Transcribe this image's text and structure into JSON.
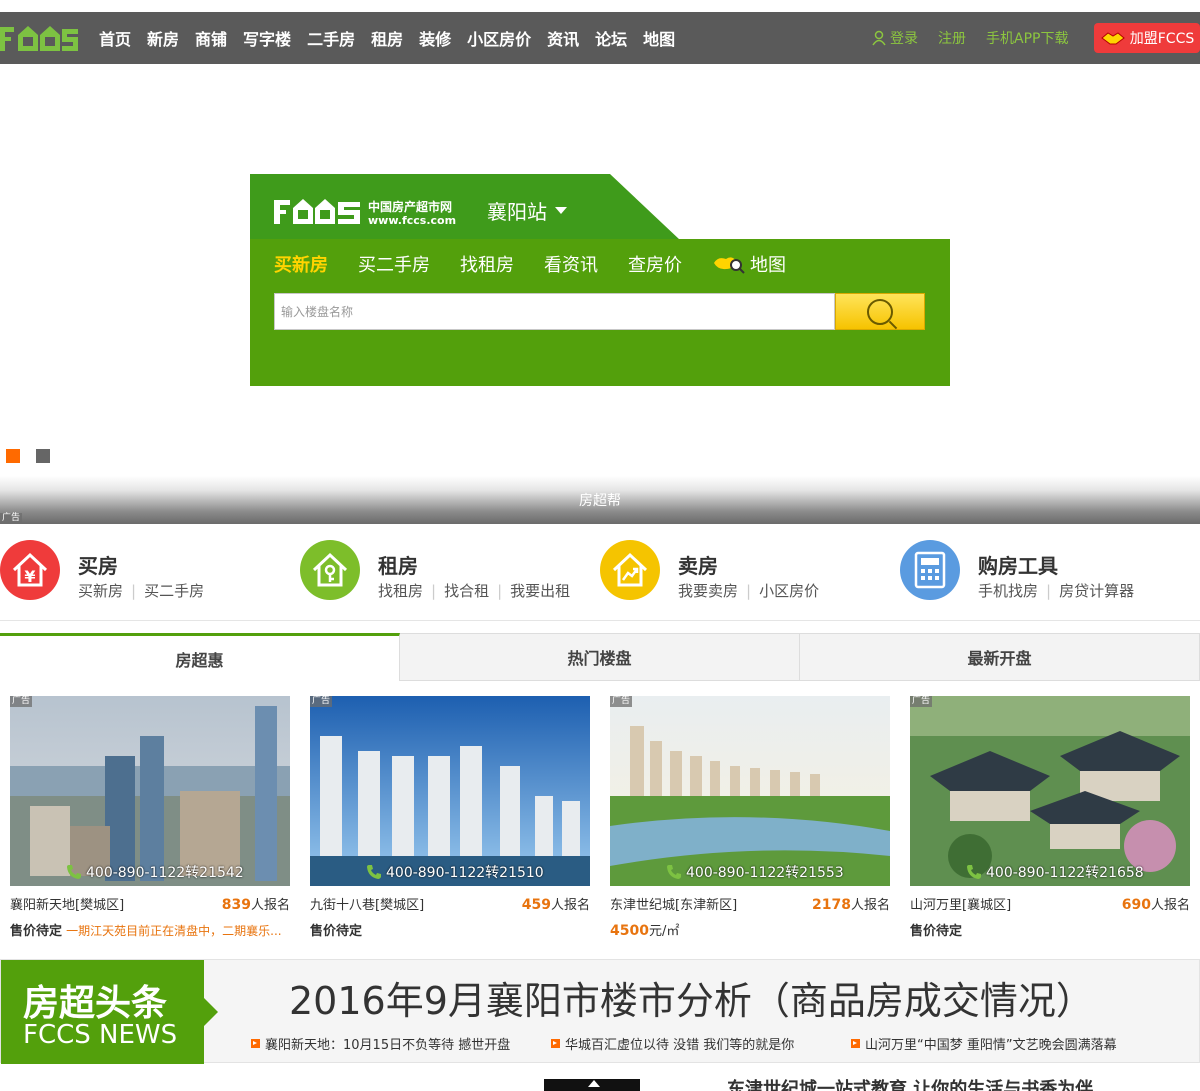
{
  "nav": {
    "logo": "FCCS",
    "items": [
      "首页",
      "新房",
      "商铺",
      "写字楼",
      "二手房",
      "租房",
      "装修",
      "小区房价",
      "资讯",
      "论坛",
      "地图"
    ],
    "login": "登录",
    "register": "注册",
    "app_download": "手机APP下载",
    "join": "加盟FCCS",
    "accent": "#8cc63f"
  },
  "search": {
    "brand": "FCCS",
    "brand_cn": "中国房产超市网",
    "brand_url": "www.fccs.com",
    "city": "襄阳站",
    "tabs": [
      "买新房",
      "买二手房",
      "找租房",
      "看资讯",
      "查房价",
      "地图"
    ],
    "active_tab": "买新房",
    "placeholder": "输入楼盘名称",
    "button_color": "#f6c300"
  },
  "carousel": {
    "pages": 2,
    "active": 1
  },
  "banner": {
    "label": "房超帮",
    "ad": "广告"
  },
  "services": [
    {
      "title": "买房",
      "links": [
        "买新房",
        "买二手房"
      ],
      "icon": "yuan-house-icon",
      "color": "#ef3b3b"
    },
    {
      "title": "租房",
      "links": [
        "找租房",
        "找合租",
        "我要出租"
      ],
      "icon": "key-house-icon",
      "color": "#7dbe2a"
    },
    {
      "title": "卖房",
      "links": [
        "我要卖房",
        "小区房价"
      ],
      "icon": "sell-house-icon",
      "color": "#f5c400"
    },
    {
      "title": "购房工具",
      "links": [
        "手机找房",
        "房贷计算器"
      ],
      "icon": "calculator-icon",
      "color": "#5a9be0"
    }
  ],
  "tabs": [
    "房超惠",
    "热门楼盘",
    "最新开盘"
  ],
  "active_tab": "房超惠",
  "cards": [
    {
      "ad": "广告",
      "phone": "400-890-1122转21542",
      "name": "襄阳新天地[樊城区]",
      "count": "839",
      "count_suffix": "人报名",
      "status": "售价待定",
      "note": "一期江天苑目前正在清盘中，二期襄乐..."
    },
    {
      "ad": "广告",
      "phone": "400-890-1122转21510",
      "name": "九街十八巷[樊城区]",
      "count": "459",
      "count_suffix": "人报名",
      "status": "售价待定",
      "note": ""
    },
    {
      "ad": "广告",
      "phone": "400-890-1122转21553",
      "name": "东津世纪城[东津新区]",
      "count": "2178",
      "count_suffix": "人报名",
      "status": "4500",
      "unit": "元/㎡",
      "note": ""
    },
    {
      "ad": "广告",
      "phone": "400-890-1122转21658",
      "name": "山河万里[襄城区]",
      "count": "690",
      "count_suffix": "人报名",
      "status": "售价待定",
      "note": ""
    }
  ],
  "news": {
    "label_cn": "房超头条",
    "label_en": "FCCS NEWS",
    "headline": "2016年9月襄阳市楼市分析（商品房成交情况）",
    "links": [
      "襄阳新天地：10月15日不负等待 撼世开盘",
      "华城百汇虚位以待 没错 我们等的就是你",
      "山河万里“中国梦 重阳情”文艺晚会圆满落幕"
    ]
  },
  "bottom": {
    "title": "东津世纪城一站式教育 让你的生活与书香为伴"
  }
}
